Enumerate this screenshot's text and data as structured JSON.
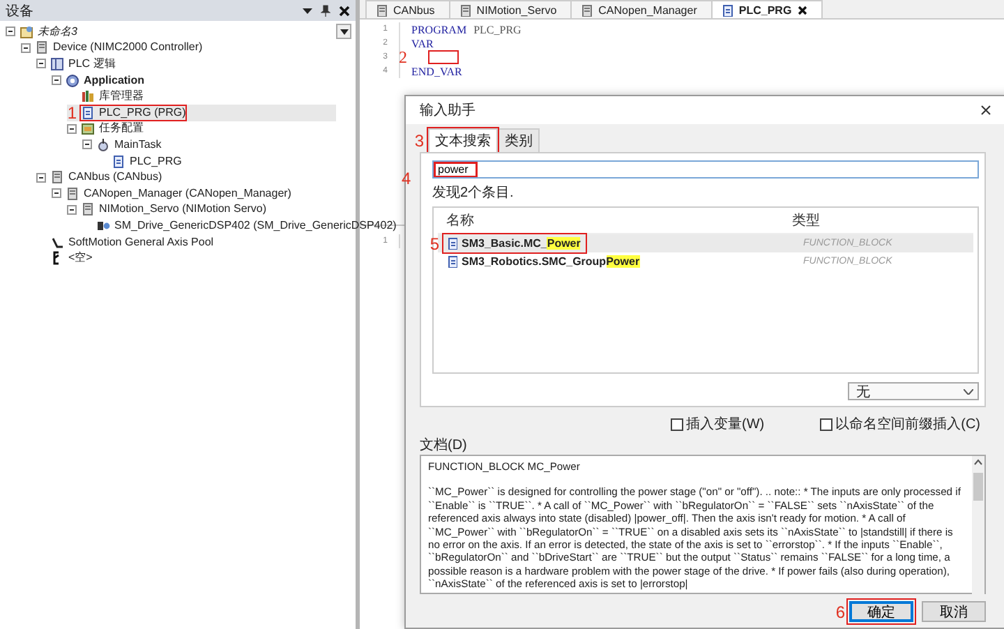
{
  "devices_panel": {
    "title": "设备",
    "tree": [
      {
        "label": "未命名3",
        "expanded": true,
        "selected": false,
        "children": [
          {
            "label": "Device (NIMC2000 Controller)",
            "expanded": true,
            "selected": false,
            "children": [
              {
                "label": "PLC 逻辑",
                "expanded": true,
                "selected": false,
                "children": [
                  {
                    "label": "Application",
                    "expanded": true,
                    "selected": false,
                    "children": [
                      {
                        "label": "库管理器",
                        "selected": false
                      },
                      {
                        "label": "PLC_PRG (PRG)",
                        "selected": true,
                        "callout": "1"
                      },
                      {
                        "label": "任务配置",
                        "expanded": true,
                        "selected": false,
                        "children": [
                          {
                            "label": "MainTask",
                            "expanded": true,
                            "selected": false,
                            "children": [
                              {
                                "label": "PLC_PRG",
                                "selected": false
                              }
                            ]
                          }
                        ]
                      }
                    ]
                  }
                ]
              },
              {
                "label": "CANbus (CANbus)",
                "expanded": true,
                "selected": false,
                "children": [
                  {
                    "label": "CANopen_Manager (CANopen_Manager)",
                    "expanded": true,
                    "selected": false,
                    "children": [
                      {
                        "label": "NIMotion_Servo (NIMotion Servo)",
                        "expanded": true,
                        "selected": false,
                        "children": [
                          {
                            "label": "SM_Drive_GenericDSP402 (SM_Drive_GenericDSP402)",
                            "selected": false
                          }
                        ]
                      }
                    ]
                  }
                ]
              },
              {
                "label": "SoftMotion General Axis Pool",
                "selected": false
              },
              {
                "label": "<空>",
                "selected": false
              }
            ]
          }
        ]
      }
    ]
  },
  "editor": {
    "tabs": [
      {
        "label": "CANbus",
        "selected": false
      },
      {
        "label": "NIMotion_Servo",
        "selected": false
      },
      {
        "label": "CANopen_Manager",
        "selected": false
      },
      {
        "label": "PLC_PRG",
        "selected": true
      }
    ],
    "declaration": [
      {
        "number": "1",
        "tokens": [
          {
            "kind": "keyword",
            "text": "PROGRAM"
          },
          {
            "kind": "name",
            "text": "PLC_PRG"
          }
        ]
      },
      {
        "number": "2",
        "tokens": [
          {
            "kind": "keyword",
            "text": "VAR"
          }
        ]
      },
      {
        "number": "3",
        "callout": "2"
      },
      {
        "number": "4",
        "tokens": [
          {
            "kind": "keyword",
            "text": "END_VAR"
          }
        ]
      }
    ],
    "body": [
      {
        "number": "1"
      }
    ]
  },
  "dialog": {
    "title": "输入助手",
    "tabs": [
      {
        "label": "文本搜索",
        "selected": true,
        "callout": "3"
      },
      {
        "label": "类别",
        "selected": false
      }
    ],
    "search": {
      "value": "power",
      "callout": "4"
    },
    "found": "发现2个条目.",
    "columns": [
      "名称",
      "类型"
    ],
    "rows": [
      {
        "prefix": "SM3_Basic.MC_",
        "match": "Power",
        "type": "FUNCTION_BLOCK",
        "selected": true,
        "callout": "5"
      },
      {
        "prefix": "SM3_Robotics.SMC_Group",
        "match": "Power",
        "type": "FUNCTION_BLOCK",
        "selected": false
      }
    ],
    "filter": "无",
    "checkboxes": [
      {
        "label": "插入变量(W)",
        "checked": false
      },
      {
        "label": "以命名空间前缀插入(C)",
        "checked": false
      }
    ],
    "docs_label": "文档(D)",
    "docs": [
      "FUNCTION_BLOCK MC_Power",
      "``MC_Power`` is designed for controlling the power stage (\"on\" or \"off\"). .. note:: * The inputs are only processed if ``Enable`` is ``TRUE``. * A call of ``MC_Power`` with ``bRegulatorOn`` = ``FALSE`` sets ``nAxisState`` of the referenced axis always into state (disabled) |power_off|. Then the axis isn't ready for motion. * A call of ``MC_Power`` with ``bRegulatorOn`` = ``TRUE`` on a disabled axis sets its ``nAxisState`` to |standstill| if there is no error on the axis. If an error is detected, the state of the axis is set to ``errorstop``. * If the inputs ``Enable``, ``bRegulatorOn`` and ``bDriveStart`` are ``TRUE`` but the output ``Status`` remains ``FALSE`` for a long time, a possible reason is a hardware problem with the power stage of the drive. * If power fails (also during operation), ``nAxisState`` of the referenced axis is set to |errorstop|"
    ],
    "buttons": [
      {
        "label": "确定",
        "kind": "default",
        "callout": "6"
      },
      {
        "label": "取消",
        "kind": "normal"
      }
    ]
  }
}
